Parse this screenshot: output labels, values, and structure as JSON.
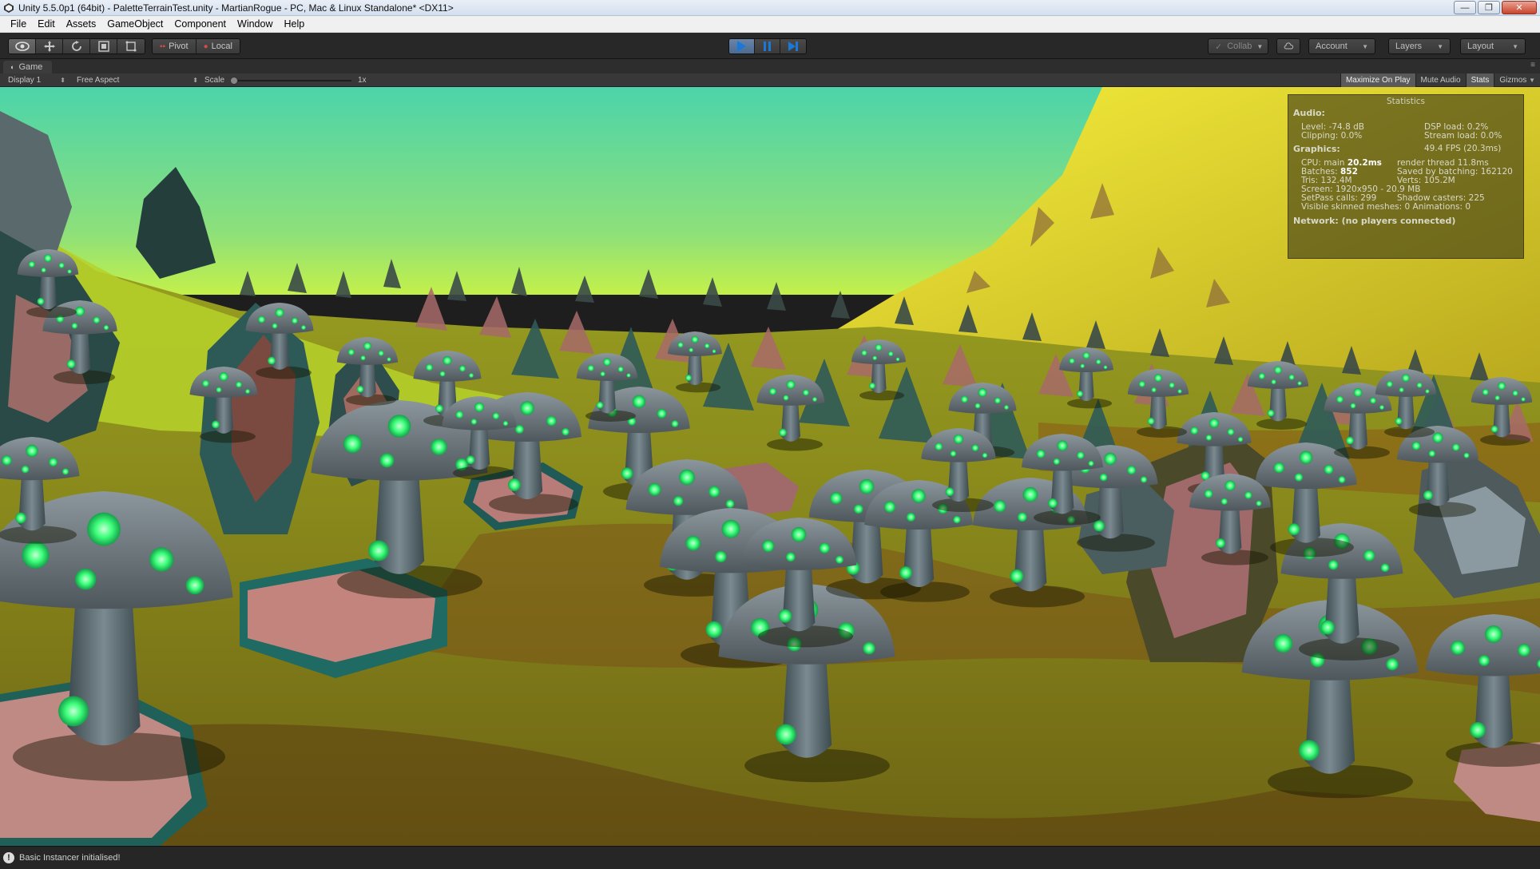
{
  "window": {
    "title": "Unity 5.5.0p1 (64bit) - PaletteTerrainTest.unity - MartianRogue - PC, Mac & Linux Standalone* <DX11>",
    "controls": {
      "minimize": "—",
      "maximize": "❐",
      "close": "✕"
    }
  },
  "menu": {
    "items": [
      {
        "label": "File"
      },
      {
        "label": "Edit"
      },
      {
        "label": "Assets"
      },
      {
        "label": "GameObject"
      },
      {
        "label": "Component"
      },
      {
        "label": "Window"
      },
      {
        "label": "Help"
      }
    ]
  },
  "toolbar": {
    "pivot_label": "Pivot",
    "local_label": "Local",
    "collab_label": "Collab",
    "account_label": "Account",
    "layers_label": "Layers",
    "layout_label": "Layout",
    "play_state": "playing"
  },
  "game_view": {
    "tab_label": "Game",
    "display_label": "Display 1",
    "aspect_label": "Free Aspect",
    "scale_label": "Scale",
    "scale_value": "1x",
    "toggles": {
      "maximize": "Maximize On Play",
      "mute": "Mute Audio",
      "stats": "Stats",
      "gizmos": "Gizmos"
    }
  },
  "stats": {
    "title": "Statistics",
    "audio_header": "Audio:",
    "level": "Level: -74.8 dB",
    "dsp_load": "DSP load: 0.2%",
    "clipping": "Clipping: 0.0%",
    "stream_load": "Stream load: 0.0%",
    "graphics_header": "Graphics:",
    "fps": "49.4 FPS (20.3ms)",
    "cpu_prefix": "CPU: main",
    "cpu_main": "20.2ms",
    "render_thread": "render thread 11.8ms",
    "batches_prefix": "Batches:",
    "batches": "852",
    "saved_batching": "Saved by batching: 162120",
    "tris": "Tris: 132.4M",
    "verts": "Verts: 105.2M",
    "screen": "Screen: 1920x950 - 20.9 MB",
    "setpass": "SetPass calls: 299",
    "shadow_casters": "Shadow casters: 225",
    "skinned": "Visible skinned meshes: 0  Animations: 0",
    "network": "Network: (no players connected)"
  },
  "status": {
    "message": "Basic Instancer initialised!"
  },
  "colors": {
    "sky_top": "#4fd6a6",
    "sky_horizon": "#b9f050",
    "ground_light": "#a8c41e",
    "ground_dark": "#6a4e12",
    "hill_yellow": "#f2ee32",
    "rock_pink": "#c88a86",
    "rock_teal": "#2a9b8c",
    "mushroom_cap": "#7e888e",
    "mushroom_glow": "#3dff7a",
    "play_blue": "#1a78d8"
  }
}
